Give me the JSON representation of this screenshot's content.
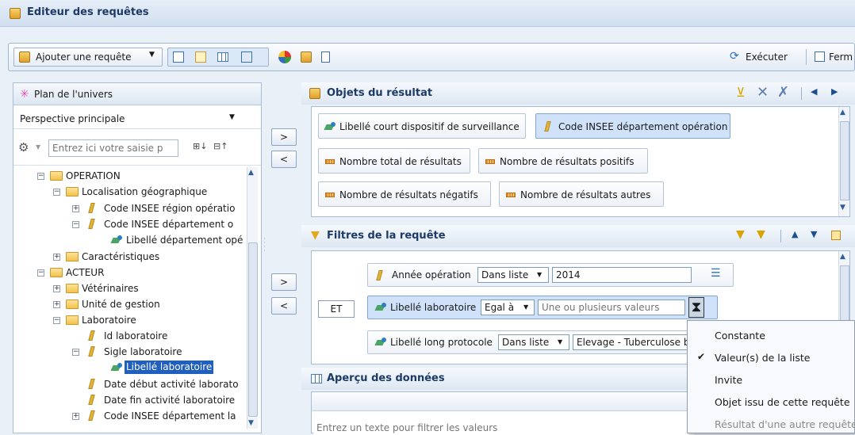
{
  "window": {
    "title": "Editeur des requêtes"
  },
  "toolbar": {
    "add_query_label": "Ajouter une requête",
    "run_label": "Exécuter",
    "close_label": "Ferm"
  },
  "universe": {
    "title": "Plan de l'univers",
    "perspective": "Perspective principale",
    "search_placeholder": "Entrez ici votre saisie p",
    "tree": [
      {
        "label": "OPERATION"
      },
      {
        "label": "Localisation géographique"
      },
      {
        "label": "Code INSEE région opératio"
      },
      {
        "label": "Code INSEE département o"
      },
      {
        "label": "Libellé département opé"
      },
      {
        "label": "Caractéristiques"
      },
      {
        "label": "ACTEUR"
      },
      {
        "label": "Vétérinaires"
      },
      {
        "label": "Unité de gestion"
      },
      {
        "label": "Laboratoire"
      },
      {
        "label": "Id laboratoire"
      },
      {
        "label": "Sigle laboratoire"
      },
      {
        "label": "Libellé laboratoire"
      },
      {
        "label": "Date début activité laborato"
      },
      {
        "label": "Date fin activité laboratoire"
      },
      {
        "label": "Code INSEE département la"
      }
    ]
  },
  "move": {
    "add": ">",
    "remove": "<"
  },
  "results": {
    "title": "Objets du résultat",
    "objects": [
      {
        "label": "Libellé court dispositif de surveillance"
      },
      {
        "label": "Code INSEE département opération"
      },
      {
        "label": "Nombre total de résultats"
      },
      {
        "label": "Nombre de résultats positifs"
      },
      {
        "label": "Nombre de résultats négatifs"
      },
      {
        "label": "Nombre de résultats autres"
      }
    ]
  },
  "filters": {
    "title": "Filtres de la requête",
    "operator": "ET",
    "rows": [
      {
        "object": "Année opération",
        "op": "Dans liste",
        "value": "2014"
      },
      {
        "object": "Libellé laboratoire",
        "op": "Egal à",
        "placeholder": "Une ou plusieurs valeurs"
      },
      {
        "object": "Libellé long protocole",
        "op": "Dans liste",
        "value": "Elevage - Tuberculose b"
      }
    ]
  },
  "preview": {
    "title": "Aperçu des données",
    "filter_placeholder": "Entrez un texte pour filtrer les valeurs"
  },
  "context_menu": {
    "items": [
      {
        "label": "Constante"
      },
      {
        "label": "Valeur(s) de la liste",
        "check": "✔"
      },
      {
        "label": "Invite"
      },
      {
        "label": "Objet issu de cette requête"
      },
      {
        "label": "Résultat d'une autre requête"
      }
    ]
  }
}
